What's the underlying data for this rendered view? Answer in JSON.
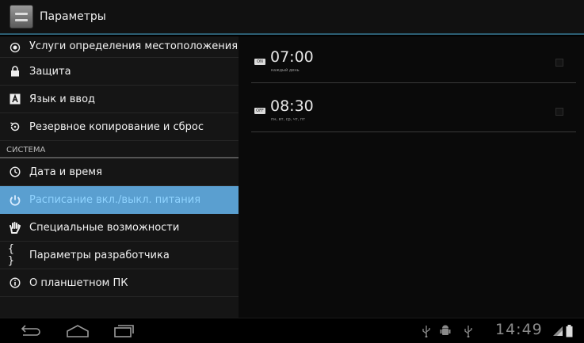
{
  "app": {
    "title": "Параметры",
    "icon": "settings-app-icon"
  },
  "settings": {
    "items": [
      {
        "label": "Услуги определения местоположения",
        "icon": "location-icon"
      },
      {
        "label": "Защита",
        "icon": "lock-icon"
      },
      {
        "label": "Язык и ввод",
        "icon": "language-icon"
      },
      {
        "label": "Резервное копирование и сброс",
        "icon": "backup-icon"
      }
    ],
    "section_header": "СИСТЕМА",
    "system_items": [
      {
        "label": "Дата и время",
        "icon": "clock-icon"
      },
      {
        "label": "Расписание вкл./выкл. питания",
        "icon": "power-schedule-icon",
        "selected": true
      },
      {
        "label": "Специальные возможности",
        "icon": "accessibility-hand-icon"
      },
      {
        "label": "Параметры разработчика",
        "icon": "braces-icon"
      },
      {
        "label": "О планшетном ПК",
        "icon": "info-icon"
      }
    ]
  },
  "schedule": {
    "alarms": [
      {
        "badge": "ON",
        "time": "07:00",
        "days": "каждый день",
        "checked": false
      },
      {
        "badge": "OFF",
        "time": "08:30",
        "days": "пн, вт, ср, чт, пт",
        "checked": false
      }
    ]
  },
  "navbar": {
    "clock": "14:49",
    "buttons": [
      "back-icon",
      "home-icon",
      "recent-apps-icon"
    ],
    "status_icons": [
      "usb-icon",
      "android-debug-icon",
      "usb-icon",
      "signal-icon",
      "battery-icon"
    ]
  },
  "colors": {
    "selected_bg": "#5a9fd0",
    "accent_line": "#2c5e73"
  }
}
